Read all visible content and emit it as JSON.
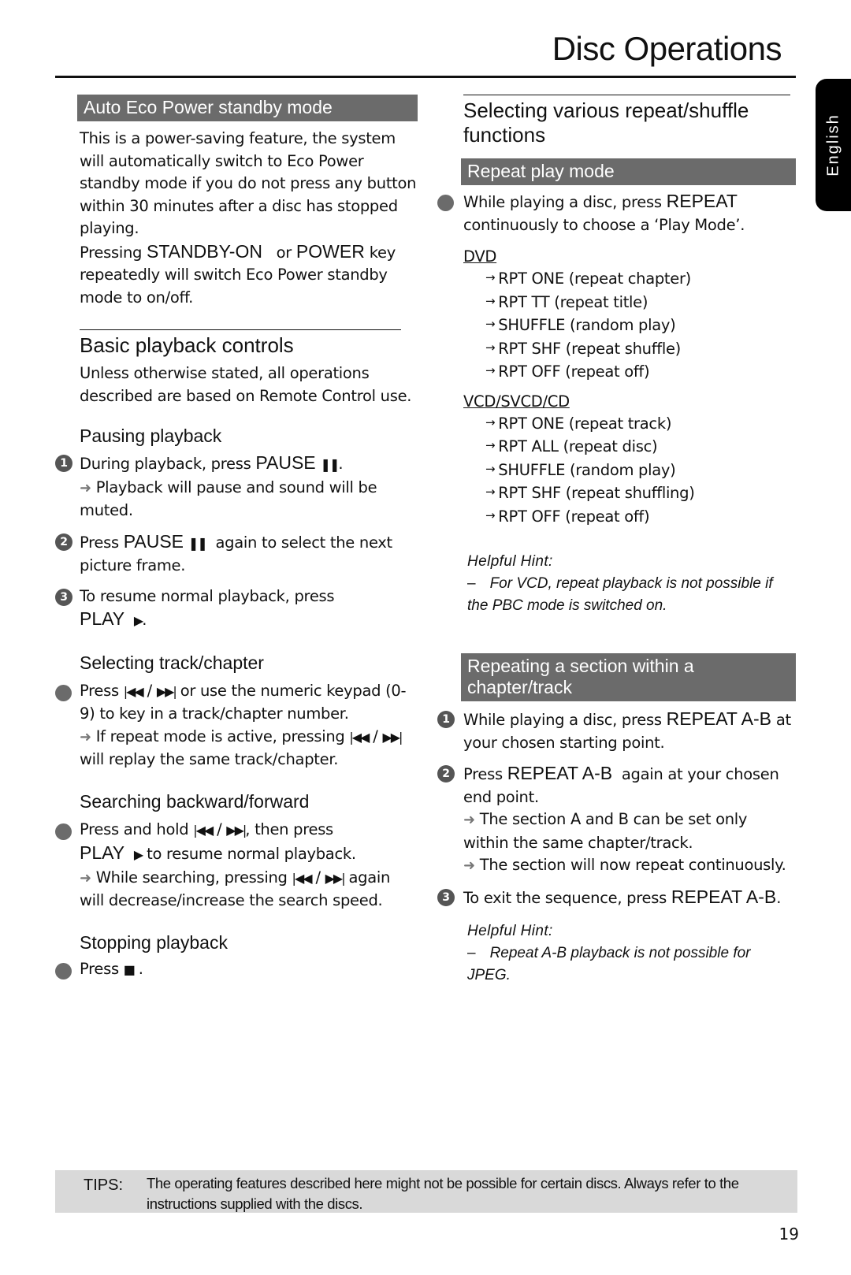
{
  "header": {
    "title": "Disc Operations",
    "language_tab": "English"
  },
  "left": {
    "eco": {
      "band": "Auto Eco Power standby mode",
      "para1": "This is a power-saving feature, the system will automatically switch to Eco Power standby mode if you do not press any button within 30 minutes after a disc has stopped playing.",
      "para2_pre": "Pressing ",
      "para2_key1": "STANDBY-ON",
      "para2_mid": "   or ",
      "para2_key2": "POWER",
      "para2_post": " key repeatedly will switch Eco Power standby mode to on/off."
    },
    "basic": {
      "heading": "Basic playback controls",
      "intro": "Unless otherwise stated, all operations described are based on Remote Control use."
    },
    "pausing": {
      "heading": "Pausing playback",
      "steps": [
        {
          "num": "1",
          "pre": "During playback, press ",
          "key": "PAUSE",
          "icon": "❚❚",
          "post": ".",
          "result": "Playback will pause and sound will be muted."
        },
        {
          "num": "2",
          "pre": "Press ",
          "key": "PAUSE",
          "icon": "❚❚",
          "post": "  again to select the next picture frame."
        },
        {
          "num": "3",
          "pre": "To resume normal playback, press ",
          "key": "PLAY",
          "icon": "▶",
          "post": "."
        }
      ]
    },
    "selecting": {
      "heading": "Selecting track/chapter",
      "pre": "Press ",
      "prev_icon": "|◀◀",
      "sep": " / ",
      "next_icon": "▶▶|",
      "post": " or use the numeric keypad (0-9) to key in a track/chapter number.",
      "result_pre": "If repeat mode is active, pressing ",
      "result_post": "  will replay the same track/chapter."
    },
    "searching": {
      "heading": "Searching backward/forward",
      "pre": "Press and hold ",
      "mid": ", then press ",
      "key": "PLAY",
      "play_icon": "▶",
      "post": " to resume normal playback.",
      "result_pre": "While searching, pressing ",
      "result_post": " again will decrease/increase the search speed."
    },
    "stopping": {
      "heading": "Stopping playback",
      "pre": "Press ",
      "icon": "■",
      "post": "."
    }
  },
  "right": {
    "heading": "Selecting various repeat/shuffle functions",
    "repeat_band": "Repeat play mode",
    "repeat_pre": "While playing a disc, press ",
    "repeat_key": "REPEAT",
    "repeat_post": " continuously to choose a ‘Play Mode’.",
    "dvd_label": "DVD",
    "dvd_modes": [
      "RPT ONE (repeat chapter)",
      "RPT TT (repeat title)",
      "SHUFFLE (random play)",
      "RPT SHF (repeat shuffle)",
      "RPT OFF (repeat off)"
    ],
    "vcd_label": "VCD/SVCD/CD",
    "vcd_modes": [
      "RPT ONE (repeat track)",
      "RPT ALL (repeat disc)",
      "SHUFFLE (random play)",
      "RPT SHF (repeat shuffling)",
      "RPT OFF (repeat off)"
    ],
    "hint1_title": "Helpful Hint:",
    "hint1_text": "For VCD, repeat playback is not possible if the PBC mode is switched on.",
    "ab_band": "Repeating a section within a chapter/track",
    "ab_steps": [
      {
        "num": "1",
        "pre": "While playing a disc, press ",
        "key": "REPEAT A-B",
        "post": " at your chosen starting point."
      },
      {
        "num": "2",
        "pre": "Press ",
        "key": "REPEAT A-B",
        "post": "  again at your chosen end point.",
        "results": [
          "The section A and B can be set only within the same chapter/track.",
          "The section will now repeat continuously."
        ]
      },
      {
        "num": "3",
        "pre": "To exit the sequence, press ",
        "key": "REPEAT A-B",
        "post": "."
      }
    ],
    "hint2_title": "Helpful Hint:",
    "hint2_text": "Repeat A-B playback is not possible for JPEG."
  },
  "footer": {
    "tips_label": "TIPS:",
    "tips_text": "The operating features described here might not be possible for certain discs.  Always refer to the instructions supplied with the discs.",
    "page_number": "19"
  },
  "symbols": {
    "dash": "–",
    "arrow": "➜",
    "small_arrow": "→"
  }
}
